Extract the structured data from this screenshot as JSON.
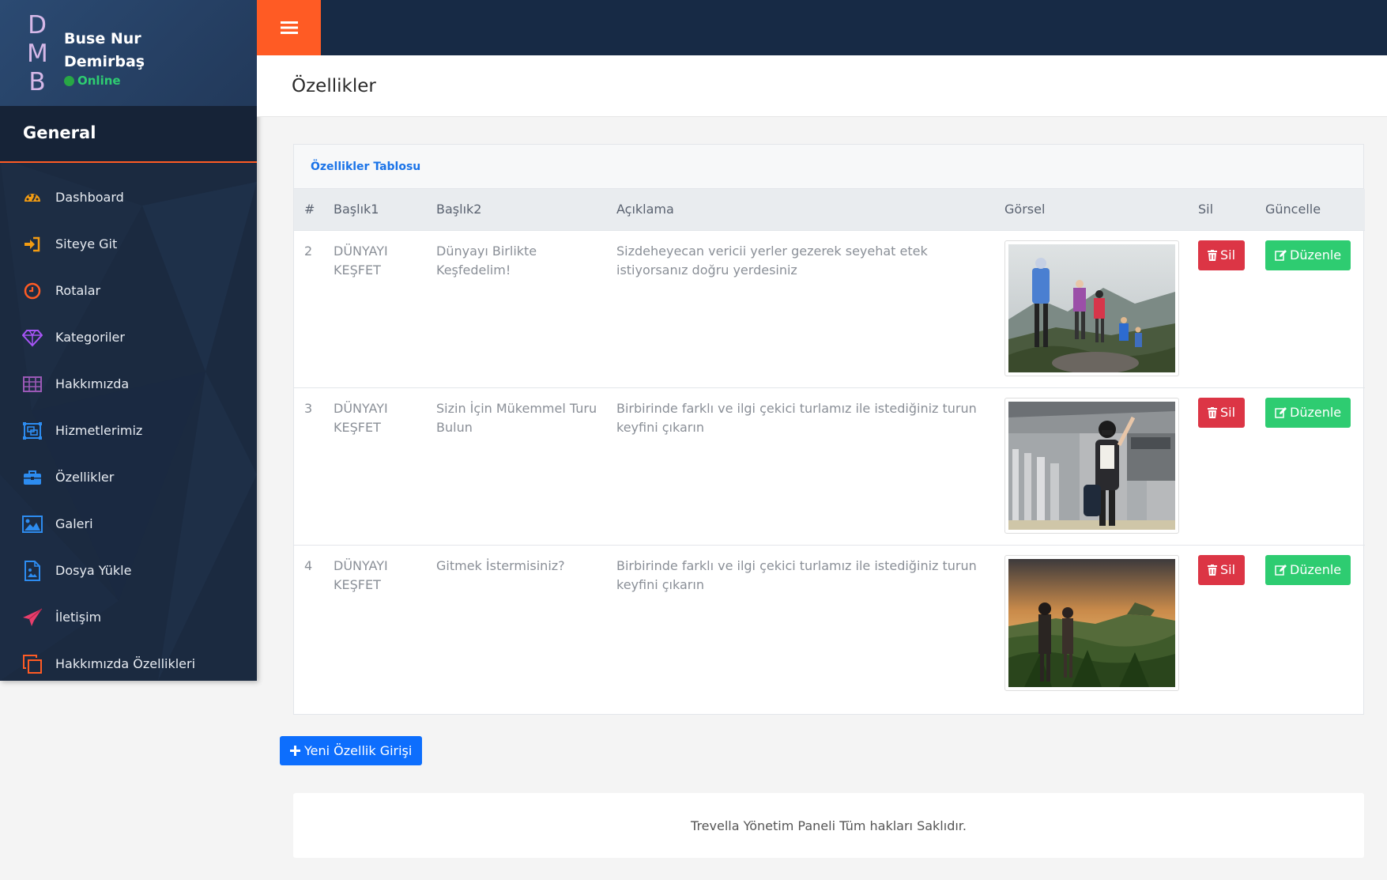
{
  "sidebar": {
    "logo_letters": [
      "D",
      "M",
      "B"
    ],
    "user_name": "Buse Nur Demirbaş",
    "status": "Online",
    "section_title": "General",
    "items": [
      {
        "label": "Dashboard",
        "icon": "dashboard-icon",
        "color": "#f39c12"
      },
      {
        "label": "Siteye Git",
        "icon": "sign-in-icon",
        "color": "#f39c12"
      },
      {
        "label": "Rotalar",
        "icon": "clock-icon",
        "color": "#ff5b24"
      },
      {
        "label": "Kategoriler",
        "icon": "diamond-icon",
        "color": "#a855f7"
      },
      {
        "label": "Hakkımızda",
        "icon": "table-icon",
        "color": "#9b59b6"
      },
      {
        "label": "Hizmetlerimiz",
        "icon": "object-group-icon",
        "color": "#2d8cf0"
      },
      {
        "label": "Özellikler",
        "icon": "briefcase-icon",
        "color": "#2d8cf0"
      },
      {
        "label": "Galeri",
        "icon": "image-icon",
        "color": "#2d8cf0"
      },
      {
        "label": "Dosya Yükle",
        "icon": "file-image-icon",
        "color": "#2d8cf0"
      },
      {
        "label": "İletişim",
        "icon": "paper-plane-icon",
        "color": "#e83e6c"
      },
      {
        "label": "Hakkımızda Özellikleri",
        "icon": "clone-icon",
        "color": "#ff5b24"
      }
    ]
  },
  "page": {
    "title": "Özellikler"
  },
  "card": {
    "title": "Özellikler Tablosu",
    "columns": [
      "#",
      "Başlık1",
      "Başlık2",
      "Açıklama",
      "Görsel",
      "Sil",
      "Güncelle"
    ],
    "rows": [
      {
        "id": "2",
        "baslik1": "DÜNYAYI KEŞFET",
        "baslik2": "Dünyayı Birlikte Keşfedelim!",
        "aciklama": "Sizdeheyecan vericii yerler gezerek seyehat etek istiyorsanız doğru yerdesiniz",
        "image": "hikers-photo",
        "delete_label": "Sil",
        "edit_label": "Düzenle"
      },
      {
        "id": "3",
        "baslik1": "DÜNYAYI KEŞFET",
        "baslik2": "Sizin İçin Mükemmel Turu Bulun",
        "aciklama": "Birbirinde farklı ve ilgi çekici turlamız ile istediğiniz turun keyfini çıkarın",
        "image": "airport-traveler-photo",
        "delete_label": "Sil",
        "edit_label": "Düzenle"
      },
      {
        "id": "4",
        "baslik1": "DÜNYAYI KEŞFET",
        "baslik2": "Gitmek İstermisiniz?",
        "aciklama": "Birbirinde farklı ve ilgi çekici turlamız ile istediğiniz turun keyfini çıkarın",
        "image": "jungle-couple-photo",
        "delete_label": "Sil",
        "edit_label": "Düzenle"
      }
    ]
  },
  "actions": {
    "new_label": "Yeni Özellik Girişi"
  },
  "footer": {
    "text": "Trevella Yönetim Paneli Tüm hakları Saklıdır."
  },
  "colors": {
    "accent": "#ff5b24",
    "sidebar_bg": "#1b2a40",
    "topbar_bg": "#172a45",
    "danger": "#dc3545",
    "success": "#2ecc71",
    "primary": "#0d6efd"
  }
}
